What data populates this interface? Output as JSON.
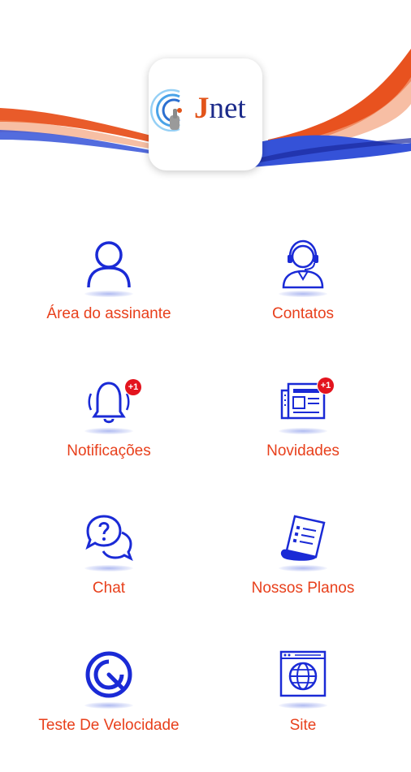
{
  "app": {
    "logo_text": "net",
    "logo_letter": "J"
  },
  "colors": {
    "accent_orange": "#e8401c",
    "icon_blue": "#1a2ad6",
    "wave_blue": "#3552d8",
    "badge_red": "#e3141e"
  },
  "menu": {
    "items": [
      {
        "label": "Área do assinante",
        "icon": "user-icon",
        "badge": ""
      },
      {
        "label": "Contatos",
        "icon": "support-agent-icon",
        "badge": ""
      },
      {
        "label": "Notificações",
        "icon": "bell-icon",
        "badge": "+1"
      },
      {
        "label": "Novidades",
        "icon": "newspaper-icon",
        "badge": "+1"
      },
      {
        "label": "Chat",
        "icon": "chat-question-icon",
        "badge": ""
      },
      {
        "label": "Nossos Planos",
        "icon": "plans-document-icon",
        "badge": ""
      },
      {
        "label": "Teste De Velocidade",
        "icon": "speedometer-icon",
        "badge": ""
      },
      {
        "label": "Site",
        "icon": "globe-browser-icon",
        "badge": ""
      }
    ]
  }
}
